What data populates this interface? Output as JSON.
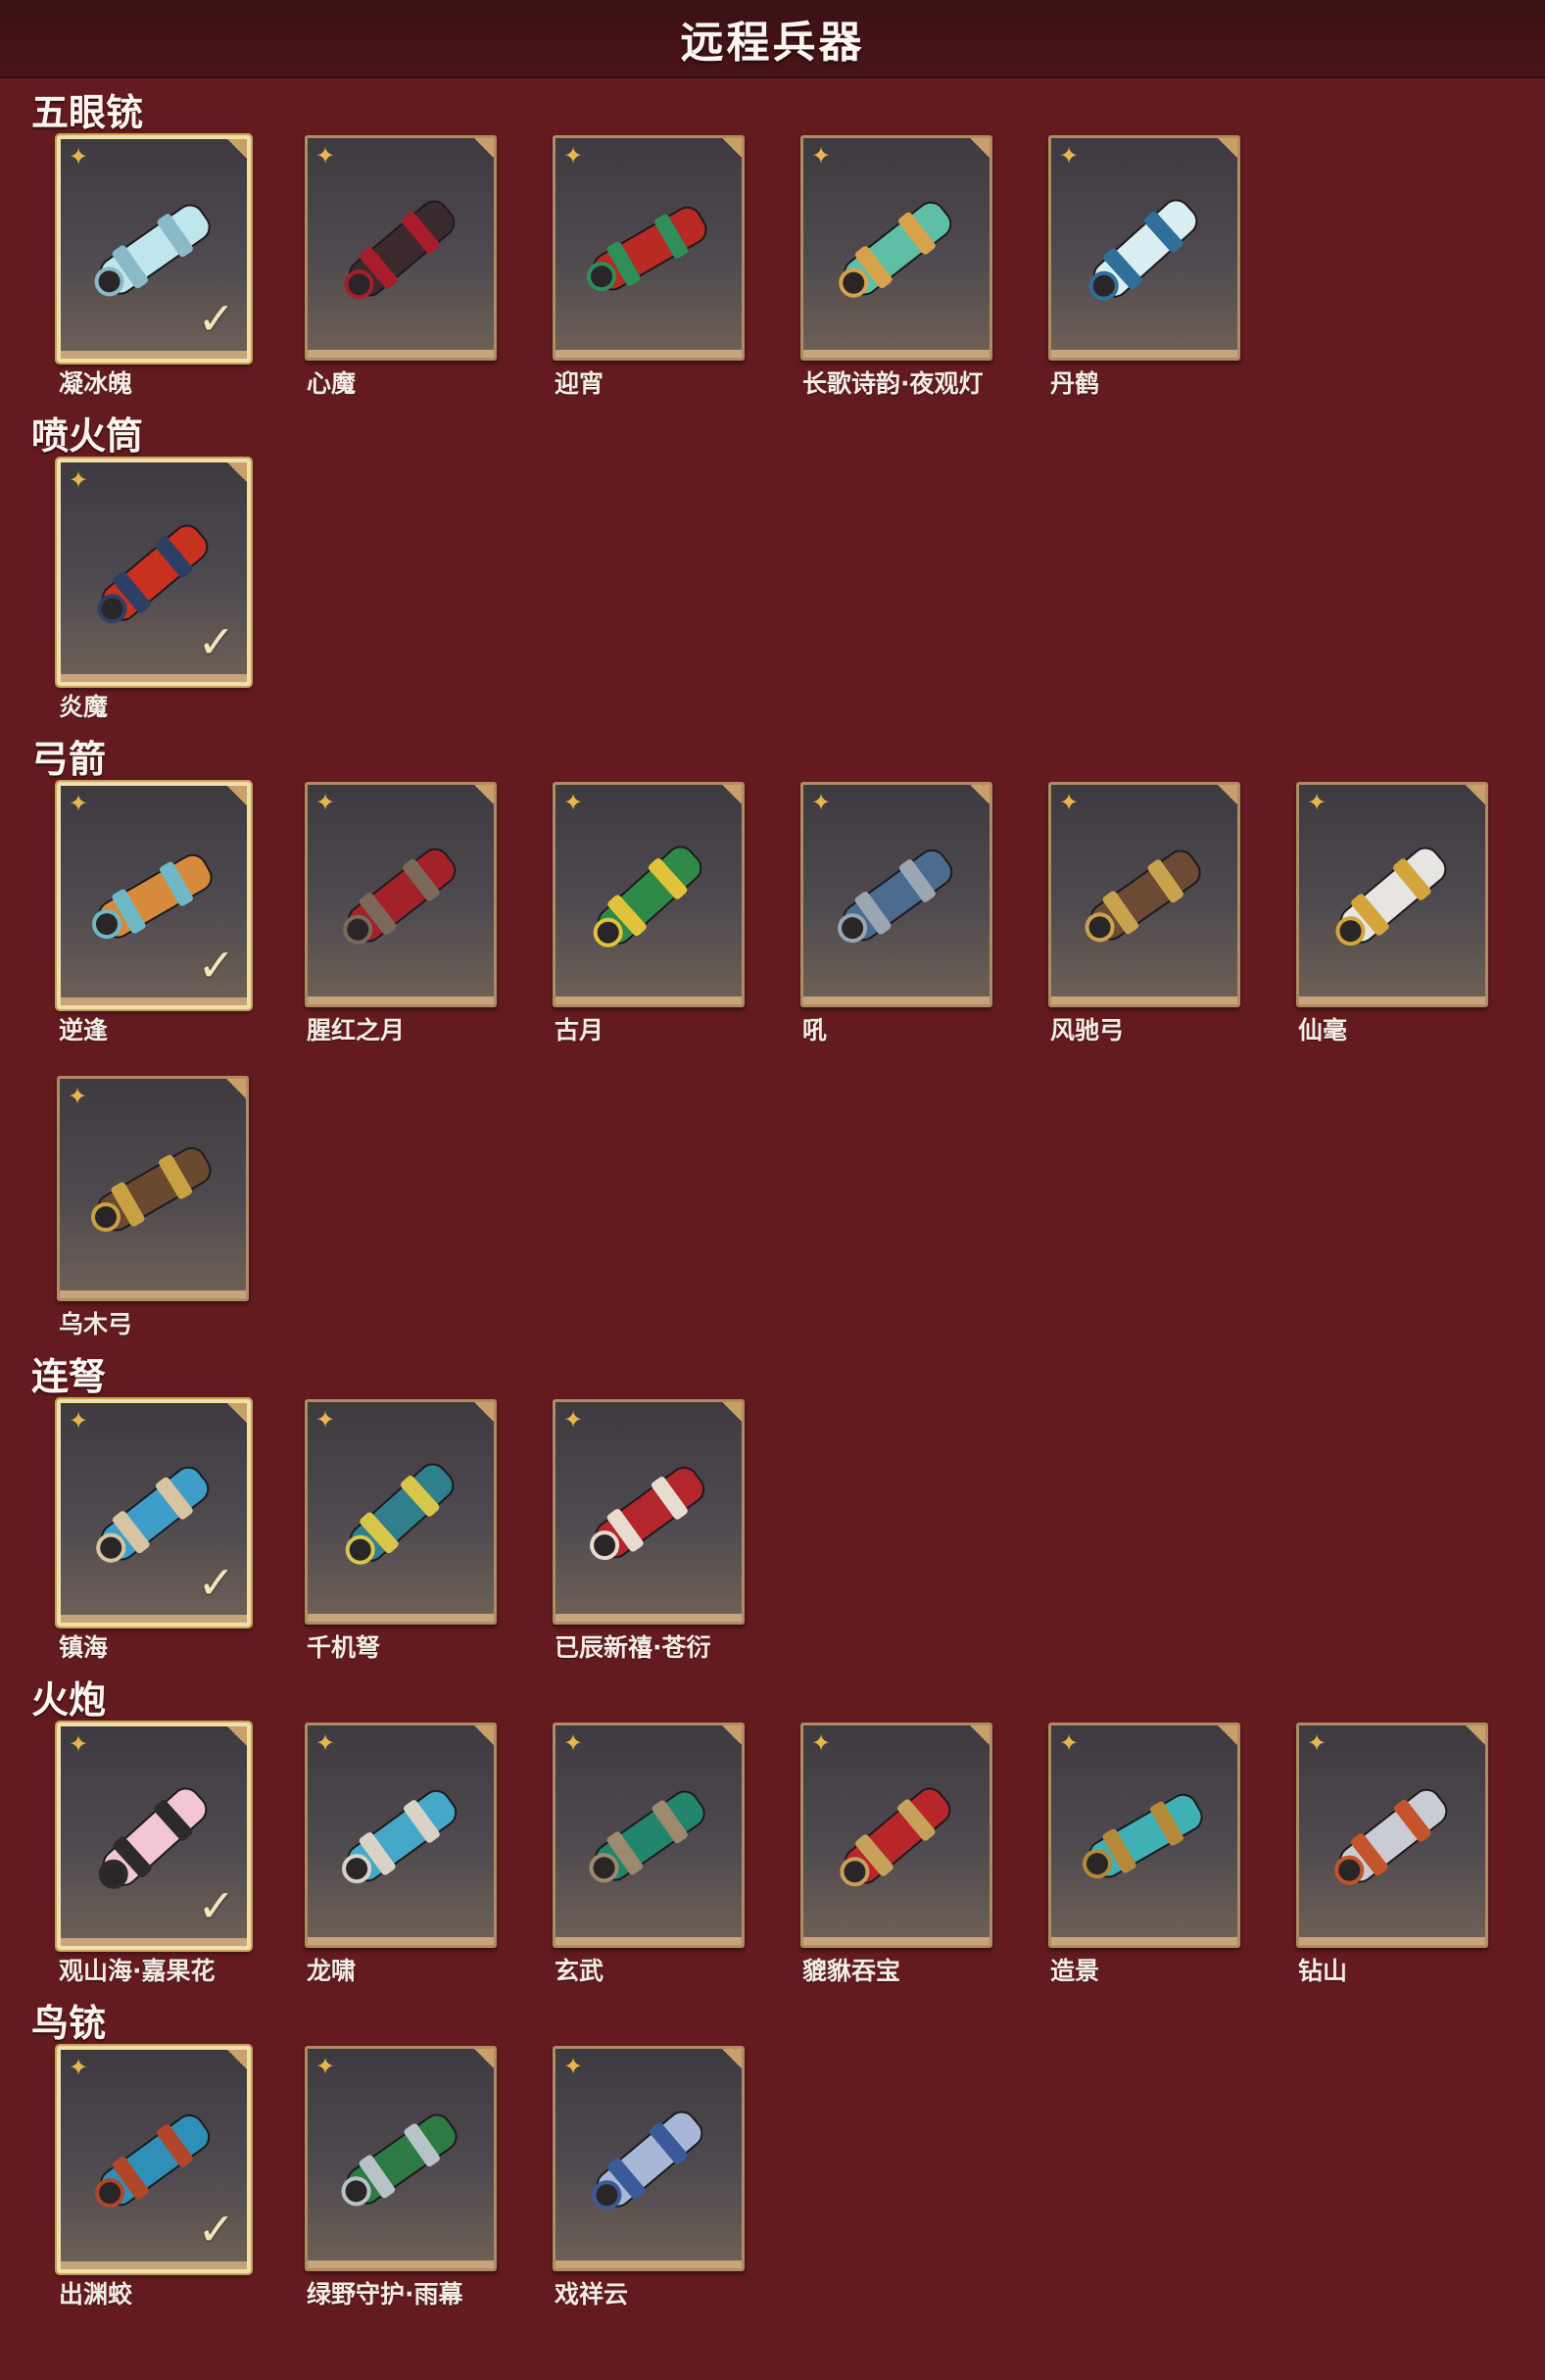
{
  "page_title": "远程兵器",
  "sections": [
    {
      "title": "五眼铳",
      "items": [
        {
          "name": "凝冰魄",
          "selected": true,
          "colors": [
            "#bfe6ef",
            "#8ab9c8"
          ]
        },
        {
          "name": "心魔",
          "selected": false,
          "colors": [
            "#3a2a2e",
            "#a81c2b"
          ]
        },
        {
          "name": "迎宵",
          "selected": false,
          "colors": [
            "#b82a24",
            "#2e8f59"
          ]
        },
        {
          "name": "长歌诗韵·夜观灯",
          "selected": false,
          "colors": [
            "#5fbfa6",
            "#d7a24c"
          ]
        },
        {
          "name": "丹鹤",
          "selected": false,
          "colors": [
            "#d9eef2",
            "#2f6f9a"
          ]
        }
      ]
    },
    {
      "title": "喷火筒",
      "items": [
        {
          "name": "炎魔",
          "selected": true,
          "colors": [
            "#c8301f",
            "#2e3f66"
          ]
        }
      ]
    },
    {
      "title": "弓箭",
      "items": [
        {
          "name": "逆逢",
          "selected": true,
          "colors": [
            "#d88a3c",
            "#6fb8c6"
          ]
        },
        {
          "name": "腥红之月",
          "selected": false,
          "colors": [
            "#a3222a",
            "#7b6a5c"
          ]
        },
        {
          "name": "古月",
          "selected": false,
          "colors": [
            "#2f8a4a",
            "#e0c33a"
          ]
        },
        {
          "name": "吼",
          "selected": false,
          "colors": [
            "#4b6b8f",
            "#9aa6b1"
          ]
        },
        {
          "name": "风驰弓",
          "selected": false,
          "colors": [
            "#6d4a34",
            "#c9a24d"
          ]
        },
        {
          "name": "仙毫",
          "selected": false,
          "colors": [
            "#e7e5e1",
            "#d3a53b"
          ]
        },
        {
          "name": "乌木弓",
          "selected": false,
          "colors": [
            "#6a4a2f",
            "#caa142"
          ]
        }
      ]
    },
    {
      "title": "连弩",
      "items": [
        {
          "name": "镇海",
          "selected": true,
          "colors": [
            "#3f9ec9",
            "#d7c4a1"
          ]
        },
        {
          "name": "千机弩",
          "selected": false,
          "colors": [
            "#2f7f8c",
            "#d8c64b"
          ]
        },
        {
          "name": "已辰新禧·苍衍",
          "selected": false,
          "colors": [
            "#b3262b",
            "#e8dcd0"
          ]
        }
      ]
    },
    {
      "title": "火炮",
      "items": [
        {
          "name": "观山海·嘉果花",
          "selected": true,
          "colors": [
            "#f2c6d2",
            "#2d2a2c"
          ]
        },
        {
          "name": "龙啸",
          "selected": false,
          "colors": [
            "#46a8c8",
            "#d8d3c6"
          ]
        },
        {
          "name": "玄武",
          "selected": false,
          "colors": [
            "#23856b",
            "#9c8a6e"
          ]
        },
        {
          "name": "貔貅吞宝",
          "selected": false,
          "colors": [
            "#b8262a",
            "#c7a15a"
          ]
        },
        {
          "name": "造景",
          "selected": false,
          "colors": [
            "#3fb0b4",
            "#b48a3a"
          ]
        },
        {
          "name": "钻山",
          "selected": false,
          "colors": [
            "#c9cdd3",
            "#c4542c"
          ]
        }
      ]
    },
    {
      "title": "鸟铳",
      "items": [
        {
          "name": "出渊蛟",
          "selected": true,
          "colors": [
            "#2f8fb6",
            "#b2462a"
          ]
        },
        {
          "name": "绿野守护·雨幕",
          "selected": false,
          "colors": [
            "#2e7a45",
            "#b8c3c8"
          ]
        },
        {
          "name": "戏祥云",
          "selected": false,
          "colors": [
            "#a8b7d8",
            "#3a5a9a"
          ]
        }
      ]
    }
  ]
}
